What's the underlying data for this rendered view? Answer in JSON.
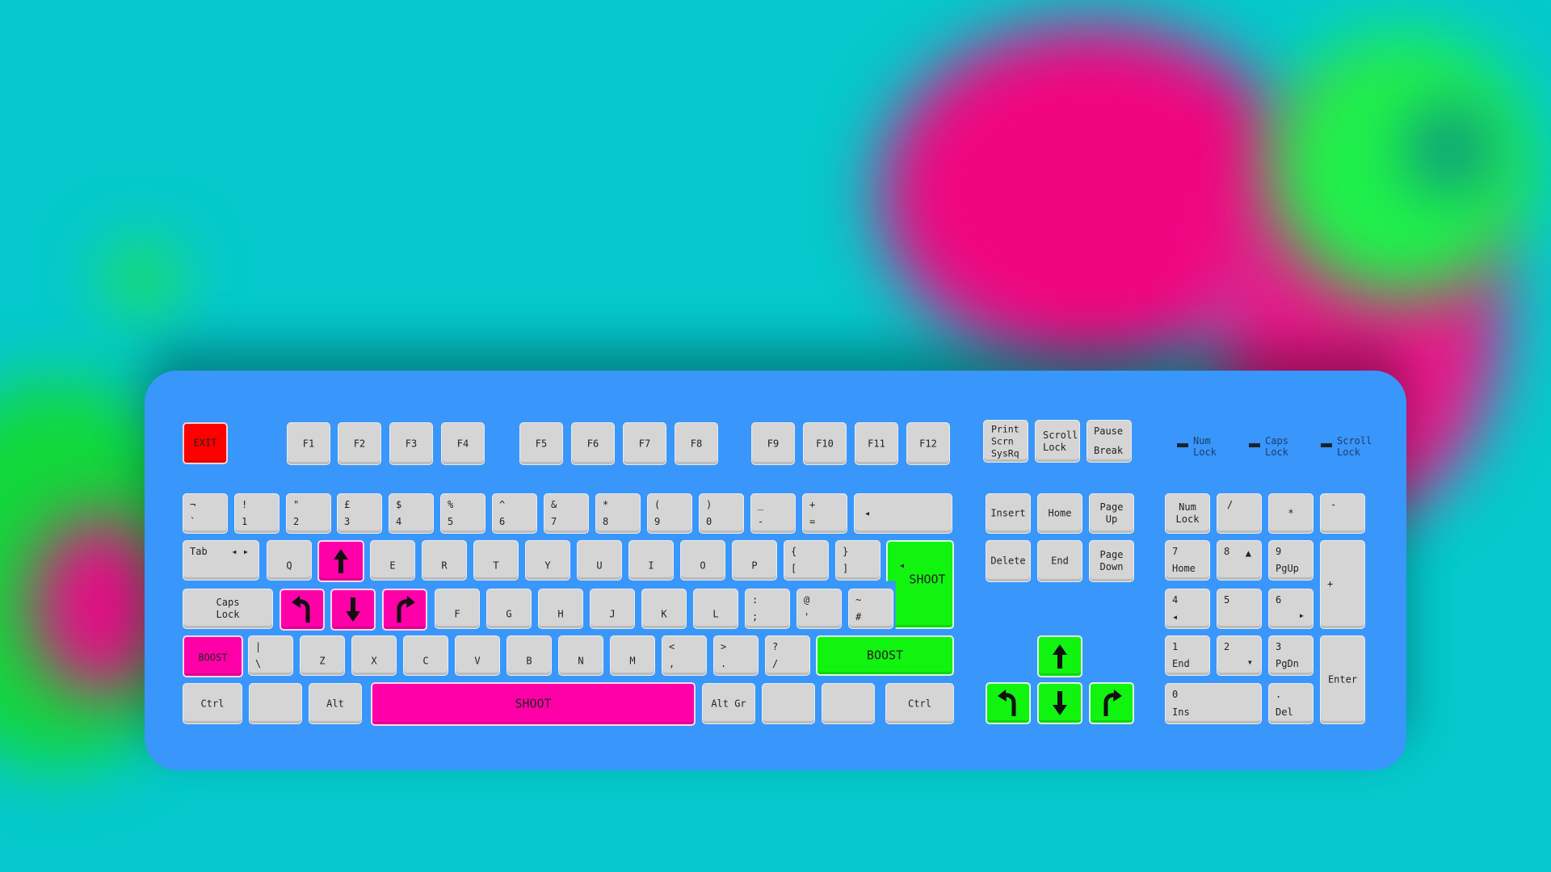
{
  "colors": {
    "background": "#05c9cc",
    "board": "#3996fb",
    "key": "#d5d5d5",
    "pink": "#ff00a8",
    "green": "#11f40f",
    "red": "#ff0000"
  },
  "keys": {
    "exit": "EXIT",
    "f1": "F1",
    "f2": "F2",
    "f3": "F3",
    "f4": "F4",
    "f5": "F5",
    "f6": "F6",
    "f7": "F7",
    "f8": "F8",
    "f9": "F9",
    "f10": "F10",
    "f11": "F11",
    "f12": "F12",
    "print": "Print\nScrn\nSysRq",
    "scroll": "Scroll\nLock",
    "pause_top": "Pause",
    "pause_bottom": "Break",
    "n1_top": "!",
    "n1_bot": "1",
    "n2_top": "\"",
    "n2_bot": "2",
    "n3_top": "£",
    "n3_bot": "3",
    "n4_top": "$",
    "n4_bot": "4",
    "n5_top": "%",
    "n5_bot": "5",
    "n6_top": "^",
    "n6_bot": "6",
    "n7_top": "&",
    "n7_bot": "7",
    "n8_top": "*",
    "n8_bot": "8",
    "n9_top": "(",
    "n9_bot": "9",
    "n0_top": ")",
    "n0_bot": "0",
    "minus_top": "_",
    "minus_bot": "-",
    "plus_top": "+",
    "plus_bot": "=",
    "grave_top": "¬",
    "grave_bot": "`",
    "backspace": "◂",
    "tab": "Tab",
    "tab_arrows": "◂\n▸",
    "q": "Q",
    "e": "E",
    "r": "R",
    "t": "T",
    "y": "Y",
    "u": "U",
    "i": "I",
    "o": "O",
    "p": "P",
    "lbrace_top": "{",
    "lbrace_bot": "[",
    "rbrace_top": "}",
    "rbrace_bot": "]",
    "caps": "Caps\nLock",
    "f": "F",
    "g": "G",
    "h": "H",
    "j": "J",
    "k": "K",
    "l": "L",
    "colon_top": ":",
    "colon_bot": ";",
    "at_top": "@",
    "at_bot": "'",
    "tilde_top": "~",
    "tilde_bot": "#",
    "pipe_top": "|",
    "pipe_bot": "\\",
    "z": "Z",
    "x": "X",
    "c": "C",
    "v": "V",
    "b": "B",
    "n": "N",
    "m": "M",
    "lt_top": "<",
    "lt_bot": ",",
    "gt_top": ">",
    "gt_bot": ".",
    "q_top": "?",
    "q_bot": "/",
    "boost": "BOOST",
    "shoot": "SHOOT",
    "enter_arrow": "◂",
    "ctrl": "Ctrl",
    "alt": "Alt",
    "altgr": "Alt Gr",
    "insert": "Insert",
    "home": "Home",
    "pageup": "Page\nUp",
    "delete": "Delete",
    "end": "End",
    "pagedown": "Page\nDown",
    "numlock": "Num\nLock",
    "kp_slash": "/",
    "kp_star": "*",
    "kp_minus": "-",
    "kp_plus": "+",
    "kp_enter": "Enter",
    "kp7_top": "7",
    "kp7_bot": "Home",
    "kp8_top": "8",
    "kp8_arrow": "▲",
    "kp9_top": "9",
    "kp9_bot": "PgUp",
    "kp4_top": "4",
    "kp4_bot": "◂",
    "kp5": "5",
    "kp6_top": "6",
    "kp6_bot": "▸",
    "kp1_top": "1",
    "kp1_bot": "End",
    "kp2_top": "2",
    "kp2_arrow": "▾",
    "kp3_top": "3",
    "kp3_bot": "PgDn",
    "kp0_top": "0",
    "kp0_bot": "Ins",
    "kpdot_top": ".",
    "kpdot_bot": "Del"
  },
  "indicators": {
    "num": "Num\nLock",
    "caps": "Caps\nLock",
    "scroll": "Scroll\nLock"
  },
  "icons": {
    "arrow_up": "arrow-up-icon",
    "arrow_down": "arrow-down-icon",
    "rotate_left": "rotate-left-icon",
    "rotate_right": "rotate-right-icon"
  }
}
